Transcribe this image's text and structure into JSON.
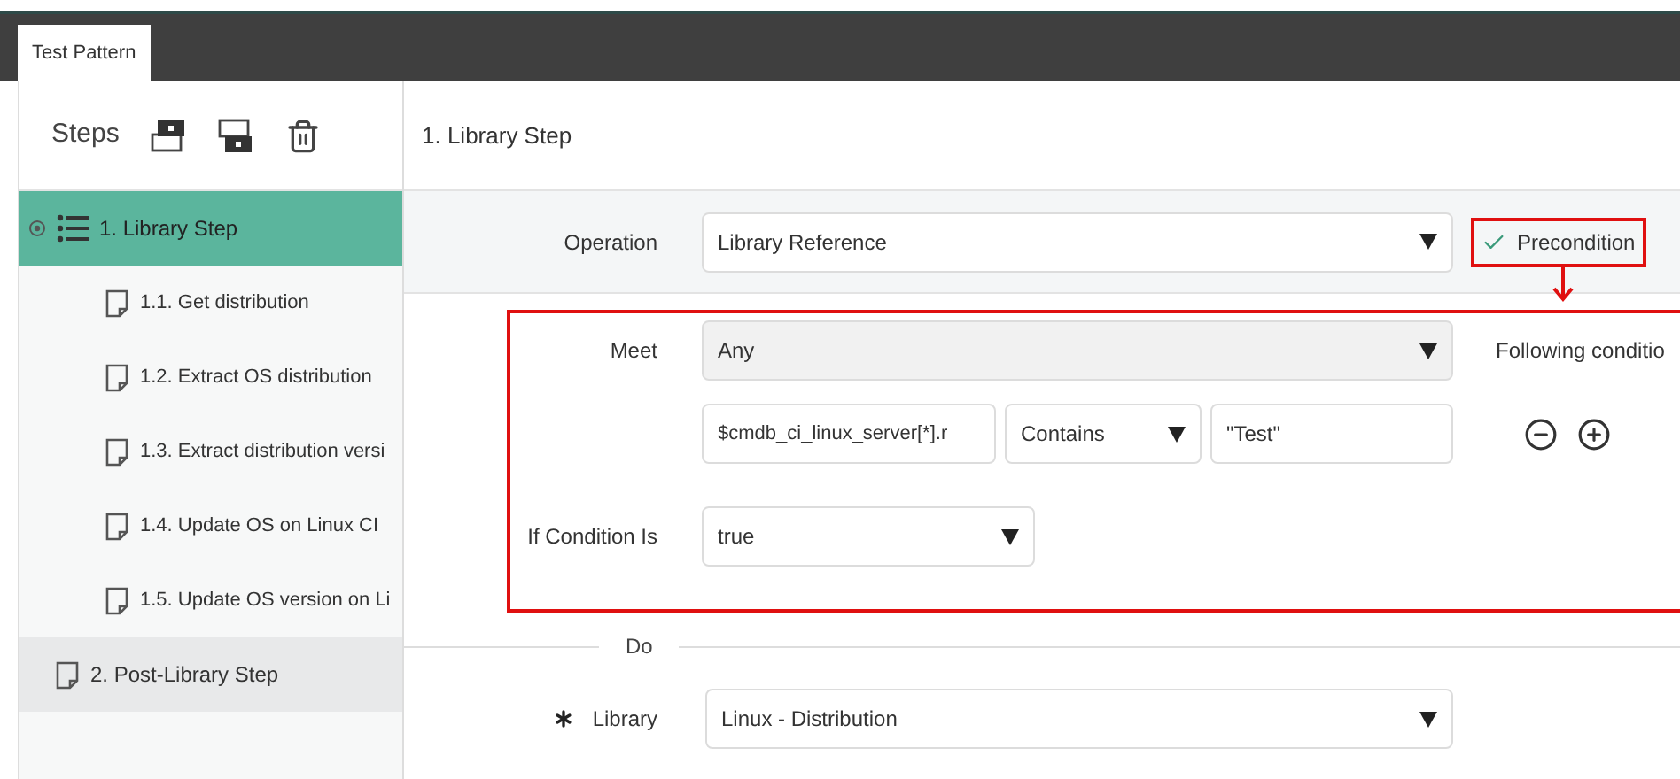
{
  "tabs": [
    {
      "label": "Test Pattern",
      "selected": true
    }
  ],
  "sidebar": {
    "title": "Steps",
    "steps": [
      {
        "label": "1. Library Step",
        "selected": true,
        "children": [
          {
            "label": "1.1. Get distribution",
            "selected": false
          },
          {
            "label": "1.2. Extract OS distribution",
            "selected": false
          },
          {
            "label": "1.3. Extract distribution versi",
            "selected": false
          },
          {
            "label": "1.4. Update OS on Linux CI",
            "selected": false
          },
          {
            "label": "1.5. Update OS version on Li",
            "selected": false
          }
        ]
      },
      {
        "label": "2. Post-Library Step",
        "selected": false
      }
    ]
  },
  "main": {
    "header": "1. Library Step",
    "operation": {
      "label": "Operation",
      "value": "Library Reference"
    },
    "precondition": {
      "label": "Precondition",
      "checked": true
    },
    "condition": {
      "meet_label": "Meet",
      "meet_value": "Any",
      "following_label": "Following conditio",
      "rule": {
        "field": "$cmdb_ci_linux_server[*].r",
        "operator": "Contains",
        "value": "\"Test\""
      },
      "if_label": "If Condition Is",
      "if_value": "true"
    },
    "do_label": "Do",
    "library": {
      "label": "Library",
      "required": true,
      "value": "Linux - Distribution"
    }
  }
}
